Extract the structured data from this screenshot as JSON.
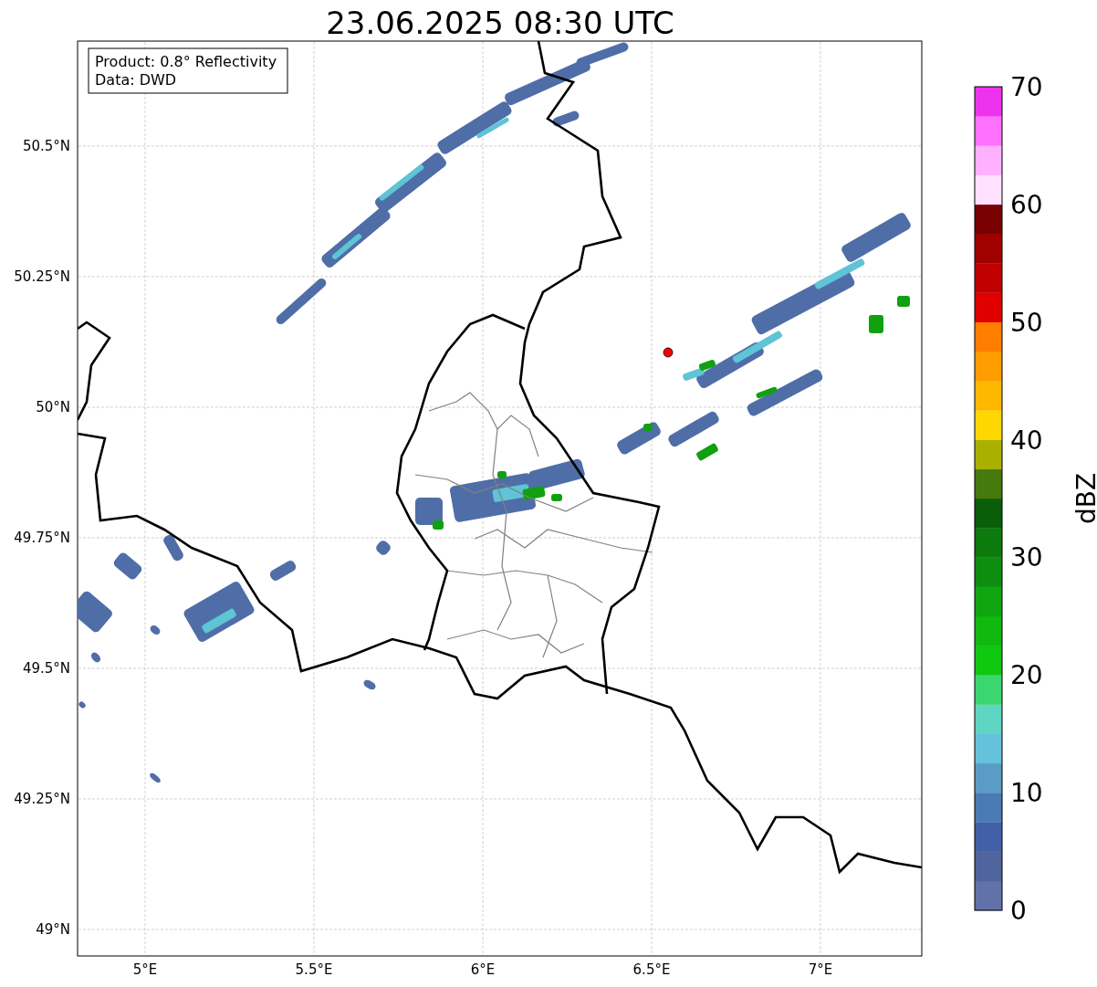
{
  "title": "23.06.2025 08:30 UTC",
  "map": {
    "info_lines": [
      "Product: 0.8° Reflectivity",
      "Data: DWD"
    ],
    "lat_labels": [
      "50.5°N",
      "50.25°N",
      "50°N",
      "49.75°N",
      "49.5°N",
      "49.25°N",
      "49°N"
    ],
    "lon_labels": [
      "5°E",
      "5.5°E",
      "6°E",
      "6.5°E",
      "7°E"
    ]
  },
  "colorbar": {
    "label": "dBZ",
    "ticks": [
      "70",
      "60",
      "50",
      "40",
      "30",
      "20",
      "10",
      "0"
    ],
    "segments": [
      {
        "color": "#6272a8"
      },
      {
        "color": "#50649e"
      },
      {
        "color": "#4260a6"
      },
      {
        "color": "#4a7ab4"
      },
      {
        "color": "#5a9cc6"
      },
      {
        "color": "#66c2dc"
      },
      {
        "color": "#5ed6c2"
      },
      {
        "color": "#3cd670"
      },
      {
        "color": "#10c810"
      },
      {
        "color": "#10b810"
      },
      {
        "color": "#10a610"
      },
      {
        "color": "#0e8e0e"
      },
      {
        "color": "#0c7a0c"
      },
      {
        "color": "#0a5e0a"
      },
      {
        "color": "#467a0e"
      },
      {
        "color": "#aab000"
      },
      {
        "color": "#ffd700"
      },
      {
        "color": "#ffb800"
      },
      {
        "color": "#ff9c00"
      },
      {
        "color": "#ff7e00"
      },
      {
        "color": "#e00000"
      },
      {
        "color": "#c00000"
      },
      {
        "color": "#a00000"
      },
      {
        "color": "#780000"
      },
      {
        "color": "#ffe0ff"
      },
      {
        "color": "#ffb0ff"
      },
      {
        "color": "#ff70ff"
      },
      {
        "color": "#ee33ee"
      }
    ]
  }
}
